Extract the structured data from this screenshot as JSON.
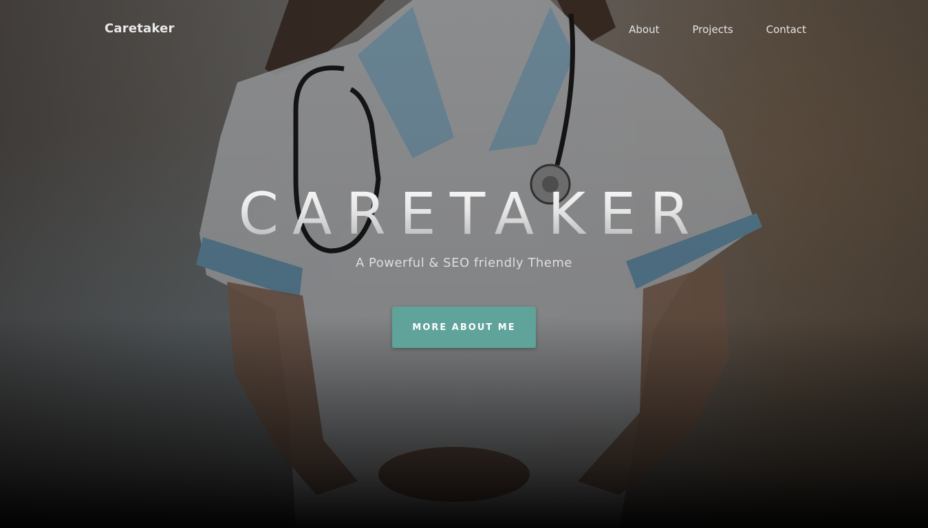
{
  "nav": {
    "brand": "Caretaker",
    "links": [
      {
        "label": "About"
      },
      {
        "label": "Projects"
      },
      {
        "label": "Contact"
      }
    ]
  },
  "hero": {
    "title": "CARETAKER",
    "subtitle": "A Powerful & SEO friendly Theme",
    "cta_label": "MORE ABOUT ME",
    "background_image": "nurse-in-white-uniform-with-stethoscope"
  },
  "colors": {
    "accent": "#5fa39b",
    "text_light": "#e4e4e4"
  }
}
